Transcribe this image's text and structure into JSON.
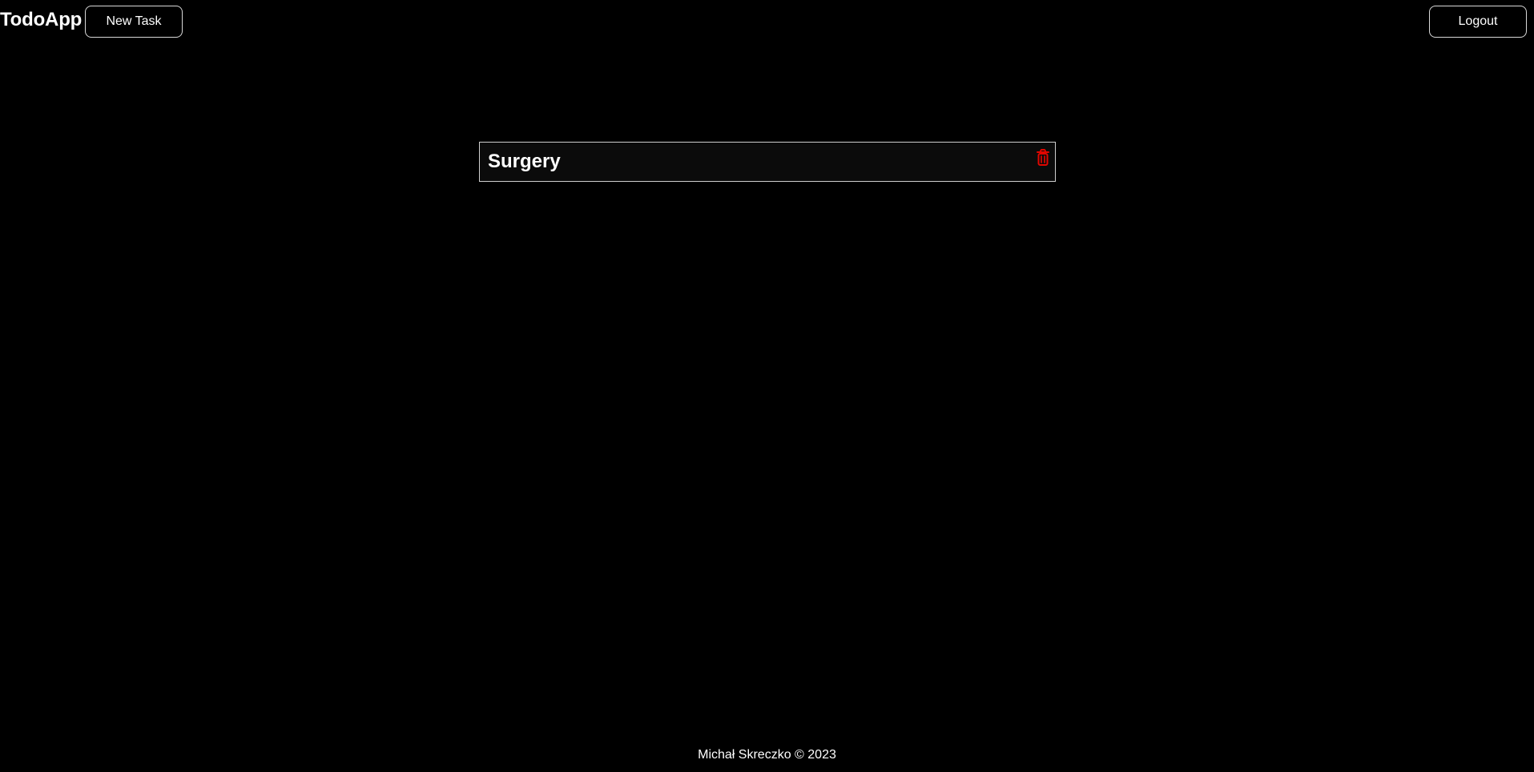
{
  "header": {
    "brand": "TodoApp",
    "new_task_label": "New Task",
    "logout_label": "Logout"
  },
  "tasks": [
    {
      "title": "Surgery",
      "delete_icon": "trash-icon"
    }
  ],
  "footer": {
    "text": "Michał Skreczko © 2023"
  },
  "colors": {
    "background": "#000000",
    "text": "#ffffff",
    "border": "#cfcfcf",
    "delete": "#e10600"
  }
}
